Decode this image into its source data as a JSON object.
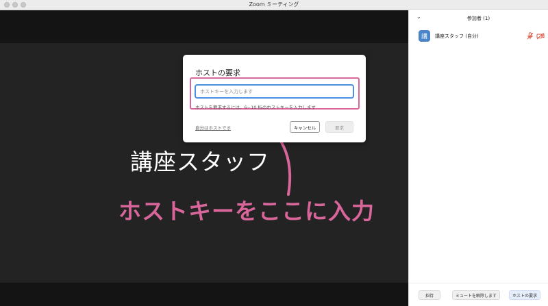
{
  "window": {
    "title": "Zoom ミーティング"
  },
  "video": {
    "name_overlay": "講座スタッフ",
    "annotation": "ホストキーをここに入力"
  },
  "dialog": {
    "title": "ホストの要求",
    "input_placeholder": "ホストキーを入力します",
    "hint": "ホストを要求するには、6~10 桁のホストキーを入力します",
    "self_host_link": "自分はホストです",
    "cancel_label": "キャンセル",
    "claim_label": "要求"
  },
  "participants": {
    "title": "参加者 (1)",
    "items": [
      {
        "avatar_letter": "講",
        "name": "講座スタッフ (自分)",
        "mic_icon": "mic-muted-icon",
        "cam_icon": "camera-off-icon"
      }
    ]
  },
  "footer": {
    "invite_label": "招待",
    "unmute_label": "ミュートを解除します",
    "claim_host_label": "ホストの要求"
  },
  "colors": {
    "annotation": "#d9669a",
    "input_focus": "#4a8fe0",
    "avatar": "#4a86c8",
    "muted_icon": "#e0533f"
  }
}
